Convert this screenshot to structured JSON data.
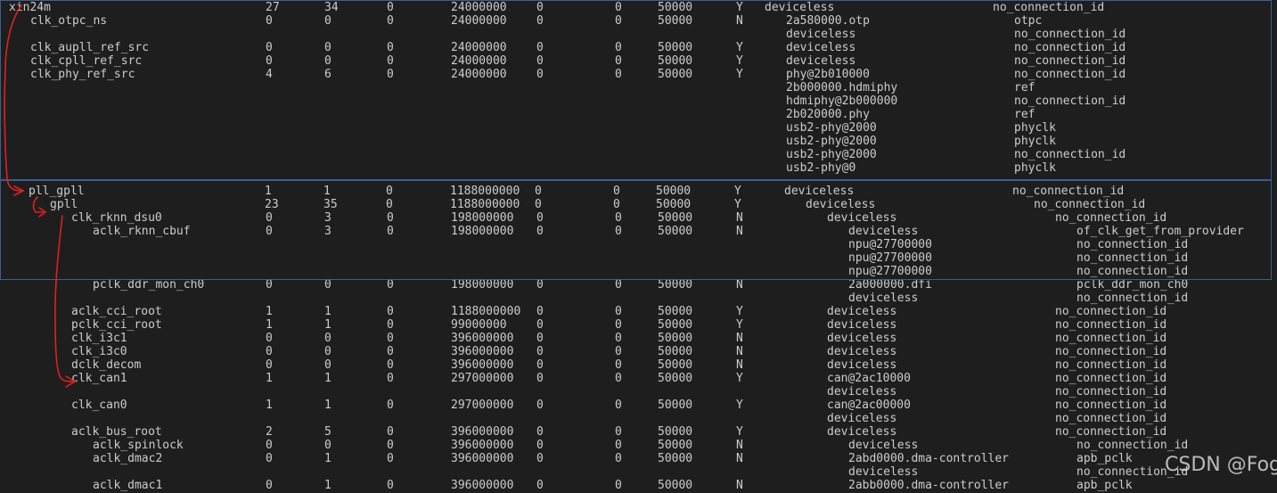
{
  "watermark": "CSDN @Fog_Fish",
  "colors": {
    "background": "#1e1e1e",
    "text": "#cccccc",
    "annotation": "#e02020",
    "highlight_box": "#3d5d8f"
  },
  "rows": [
    [
      "xin24m",
      "27",
      "34",
      "0",
      "24000000",
      "0",
      "0",
      "50000",
      "Y",
      "deviceless",
      "no_connection_id"
    ],
    [
      "clk_otpc_ns",
      "0",
      "0",
      "0",
      "24000000",
      "0",
      "0",
      "50000",
      "N",
      "2a580000.otp",
      "otpc"
    ],
    [
      "",
      "",
      "",
      "",
      "",
      "",
      "",
      "",
      "",
      "deviceless",
      "no_connection_id"
    ],
    [
      "clk_aupll_ref_src",
      "0",
      "0",
      "0",
      "24000000",
      "0",
      "0",
      "50000",
      "Y",
      "deviceless",
      "no_connection_id"
    ],
    [
      "clk_cpll_ref_src",
      "0",
      "0",
      "0",
      "24000000",
      "0",
      "0",
      "50000",
      "Y",
      "deviceless",
      "no_connection_id"
    ],
    [
      "clk_phy_ref_src",
      "4",
      "6",
      "0",
      "24000000",
      "0",
      "0",
      "50000",
      "Y",
      "phy@2b010000",
      "no_connection_id"
    ],
    [
      "",
      "",
      "",
      "",
      "",
      "",
      "",
      "",
      "",
      "2b000000.hdmiphy",
      "ref"
    ],
    [
      "",
      "",
      "",
      "",
      "",
      "",
      "",
      "",
      "",
      "hdmiphy@2b000000",
      "no_connection_id"
    ],
    [
      "",
      "",
      "",
      "",
      "",
      "",
      "",
      "",
      "",
      "2b020000.phy",
      "ref"
    ],
    [
      "",
      "",
      "",
      "",
      "",
      "",
      "",
      "",
      "",
      "usb2-phy@2000",
      "phyclk"
    ],
    [
      "",
      "",
      "",
      "",
      "",
      "",
      "",
      "",
      "",
      "usb2-phy@2000",
      "phyclk"
    ],
    [
      "",
      "",
      "",
      "",
      "",
      "",
      "",
      "",
      "",
      "usb2-phy@2000",
      "no_connection_id"
    ],
    [
      "",
      "",
      "",
      "",
      "",
      "",
      "",
      "",
      "",
      "usb2-phy@0",
      "phyclk"
    ],
    [
      "pll_gpll",
      "1",
      "1",
      "0",
      "1188000000",
      "0",
      "0",
      "50000",
      "Y",
      "deviceless",
      "no_connection_id"
    ],
    [
      "gpll",
      "23",
      "35",
      "0",
      "1188000000",
      "0",
      "0",
      "50000",
      "Y",
      "deviceless",
      "no_connection_id"
    ],
    [
      "clk_rknn_dsu0",
      "0",
      "3",
      "0",
      "198000000",
      "0",
      "0",
      "50000",
      "N",
      "deviceless",
      "no_connection_id"
    ],
    [
      "aclk_rknn_cbuf",
      "0",
      "3",
      "0",
      "198000000",
      "0",
      "0",
      "50000",
      "N",
      "deviceless",
      "of_clk_get_from_provider"
    ],
    [
      "",
      "",
      "",
      "",
      "",
      "",
      "",
      "",
      "",
      "npu@27700000",
      "no_connection_id"
    ],
    [
      "",
      "",
      "",
      "",
      "",
      "",
      "",
      "",
      "",
      "npu@27700000",
      "no_connection_id"
    ],
    [
      "",
      "",
      "",
      "",
      "",
      "",
      "",
      "",
      "",
      "npu@27700000",
      "no_connection_id"
    ],
    [
      "pclk_ddr_mon_ch0",
      "0",
      "0",
      "0",
      "198000000",
      "0",
      "0",
      "50000",
      "N",
      "2a000000.dfi",
      "pclk_ddr_mon_ch0"
    ],
    [
      "",
      "",
      "",
      "",
      "",
      "",
      "",
      "",
      "",
      "deviceless",
      "no_connection_id"
    ],
    [
      "aclk_cci_root",
      "1",
      "1",
      "0",
      "1188000000",
      "0",
      "0",
      "50000",
      "Y",
      "deviceless",
      "no_connection_id"
    ],
    [
      "pclk_cci_root",
      "1",
      "1",
      "0",
      "99000000",
      "0",
      "0",
      "50000",
      "Y",
      "deviceless",
      "no_connection_id"
    ],
    [
      "clk_i3c1",
      "0",
      "0",
      "0",
      "396000000",
      "0",
      "0",
      "50000",
      "N",
      "deviceless",
      "no_connection_id"
    ],
    [
      "clk_i3c0",
      "0",
      "0",
      "0",
      "396000000",
      "0",
      "0",
      "50000",
      "N",
      "deviceless",
      "no_connection_id"
    ],
    [
      "dclk_decom",
      "0",
      "0",
      "0",
      "396000000",
      "0",
      "0",
      "50000",
      "N",
      "deviceless",
      "no_connection_id"
    ],
    [
      "clk_can1",
      "1",
      "1",
      "0",
      "297000000",
      "0",
      "0",
      "50000",
      "Y",
      "can@2ac10000",
      "no_connection_id"
    ],
    [
      "",
      "",
      "",
      "",
      "",
      "",
      "",
      "",
      "",
      "deviceless",
      "no_connection_id"
    ],
    [
      "clk_can0",
      "1",
      "1",
      "0",
      "297000000",
      "0",
      "0",
      "50000",
      "Y",
      "can@2ac00000",
      "no_connection_id"
    ],
    [
      "",
      "",
      "",
      "",
      "",
      "",
      "",
      "",
      "",
      "deviceless",
      "no_connection_id"
    ],
    [
      "aclk_bus_root",
      "2",
      "5",
      "0",
      "396000000",
      "0",
      "0",
      "50000",
      "Y",
      "deviceless",
      "no_connection_id"
    ],
    [
      "aclk_spinlock",
      "0",
      "0",
      "0",
      "396000000",
      "0",
      "0",
      "50000",
      "N",
      "deviceless",
      "no_connection_id"
    ],
    [
      "aclk_dmac2",
      "0",
      "1",
      "0",
      "396000000",
      "0",
      "0",
      "50000",
      "N",
      "2abd0000.dma-controller",
      "apb_pclk"
    ],
    [
      "",
      "",
      "",
      "",
      "",
      "",
      "",
      "",
      "",
      "deviceless",
      "no_connection_id"
    ],
    [
      "aclk_dmac1",
      "0",
      "1",
      "0",
      "396000000",
      "0",
      "0",
      "50000",
      "N",
      "2abb0000.dma-controller",
      "apb_pclk"
    ]
  ]
}
